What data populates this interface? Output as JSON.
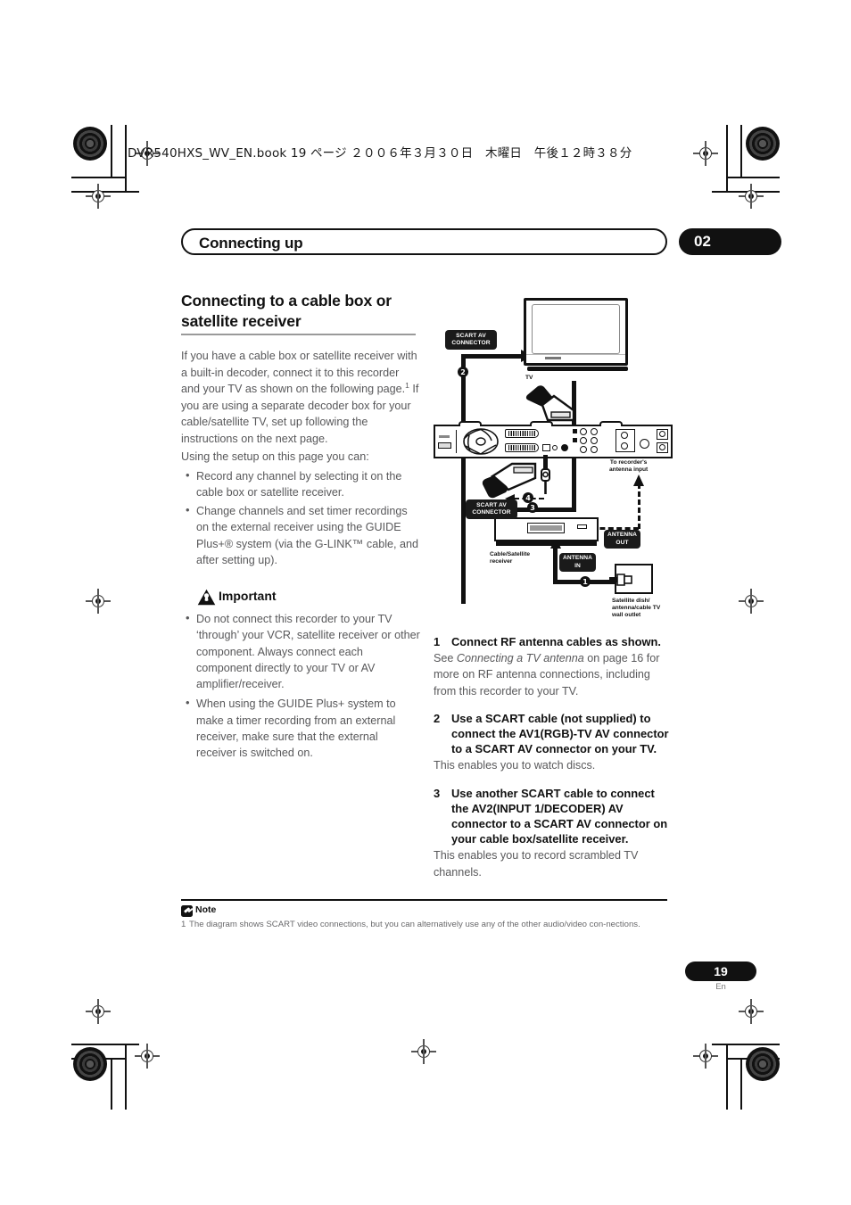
{
  "running_head": "DVR540HXS_WV_EN.book  19 ページ  ２００６年３月３０日　木曜日　午後１２時３８分",
  "chapter": {
    "title": "Connecting up",
    "number": "02"
  },
  "section": {
    "heading": "Connecting to a cable box or satellite receiver",
    "intro_1": "If you have a cable box or satellite receiver with a built-in decoder, connect it to this recorder and your TV as shown on the following page.",
    "intro_1_footnote_ref": "1",
    "intro_2": " If you are using a separate decoder box for your cable/satellite TV, set up following the instructions on the next page.",
    "intro_3": "Using the setup on this page you can:",
    "bullets": [
      "Record any channel by selecting it on the cable box or satellite receiver.",
      "Change channels and set timer recordings on the external receiver using the GUIDE Plus+® system (via the G-LINK™ cable, and after setting up)."
    ]
  },
  "important": {
    "heading": "Important",
    "icon": "warning-triangle-icon",
    "bullets": [
      "Do not connect this recorder to your TV ‘through’ your VCR, satellite receiver or other component. Always connect each component directly to your TV or AV amplifier/receiver.",
      "When using the GUIDE Plus+ system to make a timer recording from an external receiver, make sure that the external receiver is switched on."
    ]
  },
  "steps": [
    {
      "number": "1",
      "heading": "Connect RF antenna cables as shown.",
      "body_pre": "See ",
      "body_italic": "Connecting a TV antenna",
      "body_post": " on page 16 for more on RF antenna connections, including from this recorder to your TV."
    },
    {
      "number": "2",
      "heading": "Use a SCART cable (not supplied) to connect the AV1(RGB)-TV AV connector to a SCART AV connector on your TV.",
      "body_pre": "This enables you to watch discs.",
      "body_italic": "",
      "body_post": ""
    },
    {
      "number": "3",
      "heading": "Use another SCART cable to connect the AV2(INPUT 1/DECODER) AV connector to a SCART AV connector on your cable box/satellite receiver.",
      "body_pre": "This enables you to record scrambled TV channels.",
      "body_italic": "",
      "body_post": ""
    }
  ],
  "note": {
    "heading": "Note",
    "icon": "note-pencil-icon",
    "number": "1",
    "text": "The diagram shows SCART video connections, but you can alternatively use any of the other audio/video con-nections."
  },
  "footer": {
    "page_number": "19",
    "language": "En"
  },
  "diagram": {
    "labels": {
      "scart_av_connector_top": "SCART AV\nCONNECTOR",
      "scart_av_connector_bottom": "SCART AV\nCONNECTOR",
      "tv": "TV",
      "to_recorder_antenna_input": "To recorder's\nantenna input",
      "cable_satellite_receiver": "Cable/Satellite\nreceiver",
      "antenna_out": "ANTENNA\nOUT",
      "antenna_in": "ANTENNA\nIN",
      "wall_outlet": "Satellite dish/\nantenna/cable TV\nwall outlet"
    },
    "markers": [
      "1",
      "2",
      "3",
      "4"
    ]
  },
  "colors": {
    "ink": "#231f20",
    "body_text": "#58585a",
    "accent_black": "#111111",
    "rule_gray": "#9a9a9a"
  }
}
